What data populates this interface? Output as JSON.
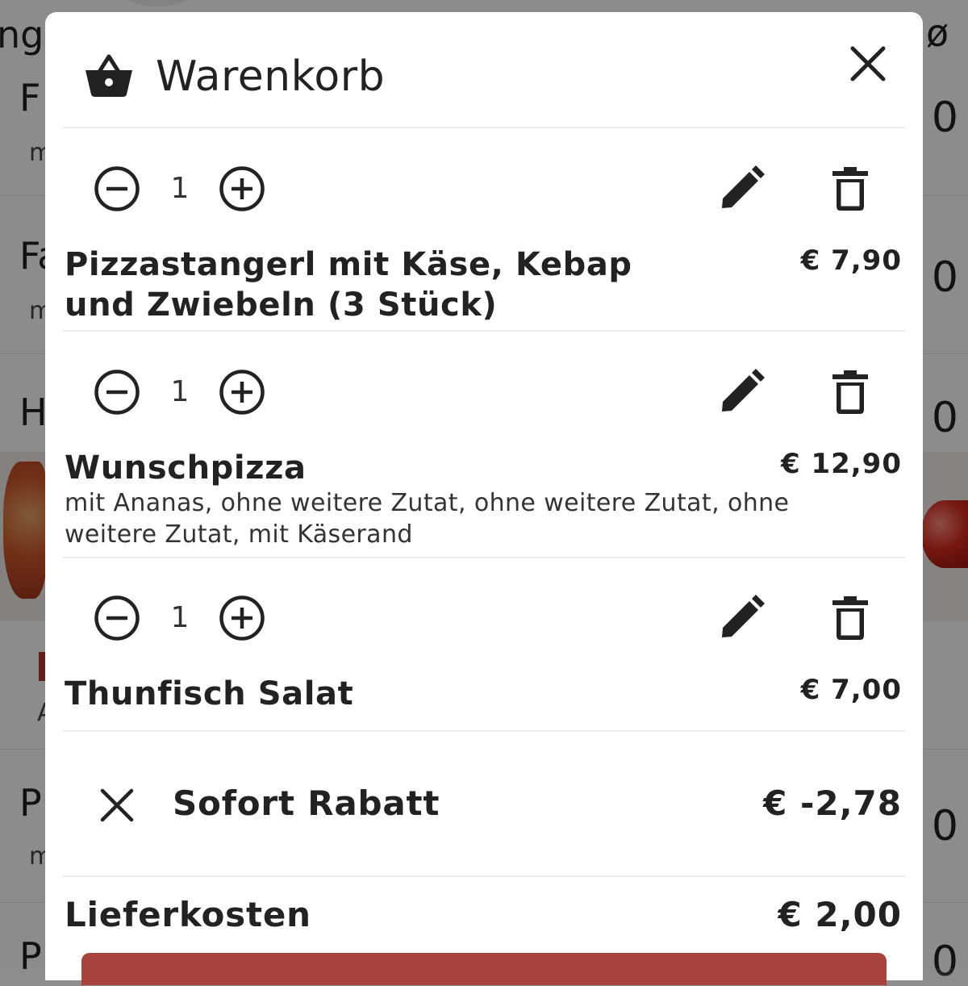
{
  "background": {
    "top_left_text": "nge",
    "top_right_text": "ø",
    "rows": [
      {
        "title": "F",
        "sub": "m",
        "price": "0"
      },
      {
        "title": "Fa",
        "sub": "m",
        "price": "0"
      },
      {
        "title": "H",
        "sub": "",
        "price": "0"
      },
      {
        "title": "",
        "sub": "A",
        "price": ""
      },
      {
        "title": "P",
        "sub": "m",
        "price": "0"
      },
      {
        "title": "P",
        "sub": "",
        "price": "0"
      }
    ]
  },
  "cart": {
    "title": "Warenkorb",
    "items": [
      {
        "quantity": "1",
        "name": "Pizzastangerl mit Käse, Kebap und Zwiebeln (3 Stück)",
        "price": "€ 7,90",
        "description": ""
      },
      {
        "quantity": "1",
        "name": "Wunschpizza",
        "price": "€ 12,90",
        "description": "mit Ananas, ohne weitere Zutat, ohne weitere Zutat, ohne weitere Zutat, mit Käserand"
      },
      {
        "quantity": "1",
        "name": "Thunfisch Salat",
        "price": "€ 7,00",
        "description": ""
      }
    ],
    "discount": {
      "label": "Sofort Rabatt",
      "amount": "€ -2,78"
    },
    "delivery": {
      "label": "Lieferkosten",
      "amount": "€ 2,00"
    }
  },
  "colors": {
    "checkout_button": "#a8423d",
    "overlay": "rgba(0,0,0,0.45)"
  },
  "icons": [
    "basket-icon",
    "close-icon",
    "minus-circle-icon",
    "plus-circle-icon",
    "pencil-icon",
    "trash-icon",
    "x-icon"
  ]
}
